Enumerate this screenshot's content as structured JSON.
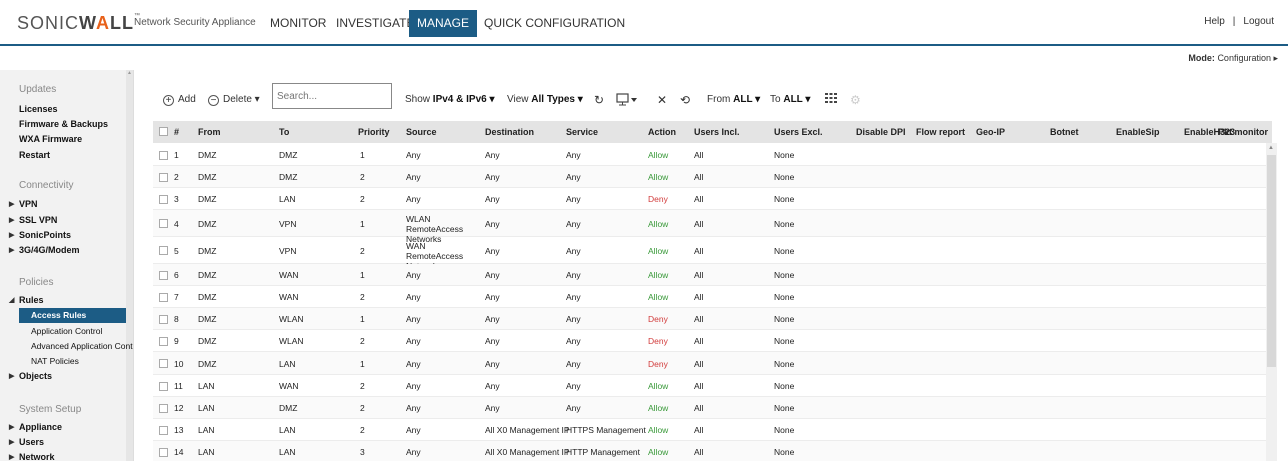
{
  "header": {
    "logo_pre": "SONIC",
    "logo_bold": "W",
    "logo_flame": "A",
    "logo_post": "LL",
    "logo_tm": "™",
    "appliance": "Network Security Appliance",
    "nav": [
      "MONITOR",
      "INVESTIGATE",
      "MANAGE",
      "QUICK CONFIGURATION"
    ],
    "active_nav": "MANAGE",
    "help": "Help",
    "sep": "|",
    "logout": "Logout",
    "mode_label": "Mode:",
    "mode_value": "Configuration ▸"
  },
  "sidebar": {
    "sections": [
      {
        "heading": "Updates",
        "items": [
          "Licenses",
          "Firmware & Backups",
          "WXA Firmware",
          "Restart"
        ]
      },
      {
        "heading": "Connectivity",
        "items": [
          "VPN",
          "SSL VPN",
          "SonicPoints",
          "3G/4G/Modem"
        ]
      },
      {
        "heading": "Policies",
        "items": [
          "Rules",
          "Access Rules",
          "Application Control",
          "Advanced Application Control",
          "NAT Policies",
          "Objects"
        ]
      },
      {
        "heading": "System Setup",
        "items": [
          "Appliance",
          "Users",
          "Network"
        ]
      }
    ],
    "active_item": "Access Rules"
  },
  "toolbar": {
    "add": "Add",
    "delete": "Delete ▾",
    "search_placeholder": "Search...",
    "show_label": "Show",
    "show_value": "IPv4 & IPv6 ▾",
    "view_label": "View",
    "view_value": "All Types ▾",
    "from_label": "From",
    "from_value": "ALL ▾",
    "to_label": "To",
    "to_value": "ALL ▾"
  },
  "table": {
    "columns": [
      "#",
      "From",
      "To",
      "Priority",
      "Source",
      "Destination",
      "Service",
      "Action",
      "Users Incl.",
      "Users Excl.",
      "Disable DPI",
      "Flow report",
      "Geo-IP",
      "Botnet",
      "EnableSip",
      "EnableH323",
      "Pkt monitor"
    ],
    "rows": [
      {
        "n": "1",
        "from": "DMZ",
        "to": "DMZ",
        "priority": "1",
        "source": "Any",
        "destination": "Any",
        "service": "Any",
        "action": "Allow",
        "incl": "All",
        "excl": "None"
      },
      {
        "n": "2",
        "from": "DMZ",
        "to": "DMZ",
        "priority": "2",
        "source": "Any",
        "destination": "Any",
        "service": "Any",
        "action": "Allow",
        "incl": "All",
        "excl": "None"
      },
      {
        "n": "3",
        "from": "DMZ",
        "to": "LAN",
        "priority": "2",
        "source": "Any",
        "destination": "Any",
        "service": "Any",
        "action": "Deny",
        "incl": "All",
        "excl": "None"
      },
      {
        "n": "4",
        "from": "DMZ",
        "to": "VPN",
        "priority": "1",
        "source": "WLAN RemoteAccess Networks",
        "destination": "Any",
        "service": "Any",
        "action": "Allow",
        "incl": "All",
        "excl": "None"
      },
      {
        "n": "5",
        "from": "DMZ",
        "to": "VPN",
        "priority": "2",
        "source": "WAN RemoteAccess Networks",
        "destination": "Any",
        "service": "Any",
        "action": "Allow",
        "incl": "All",
        "excl": "None"
      },
      {
        "n": "6",
        "from": "DMZ",
        "to": "WAN",
        "priority": "1",
        "source": "Any",
        "destination": "Any",
        "service": "Any",
        "action": "Allow",
        "incl": "All",
        "excl": "None"
      },
      {
        "n": "7",
        "from": "DMZ",
        "to": "WAN",
        "priority": "2",
        "source": "Any",
        "destination": "Any",
        "service": "Any",
        "action": "Allow",
        "incl": "All",
        "excl": "None"
      },
      {
        "n": "8",
        "from": "DMZ",
        "to": "WLAN",
        "priority": "1",
        "source": "Any",
        "destination": "Any",
        "service": "Any",
        "action": "Deny",
        "incl": "All",
        "excl": "None"
      },
      {
        "n": "9",
        "from": "DMZ",
        "to": "WLAN",
        "priority": "2",
        "source": "Any",
        "destination": "Any",
        "service": "Any",
        "action": "Deny",
        "incl": "All",
        "excl": "None"
      },
      {
        "n": "10",
        "from": "DMZ",
        "to": "LAN",
        "priority": "1",
        "source": "Any",
        "destination": "Any",
        "service": "Any",
        "action": "Deny",
        "incl": "All",
        "excl": "None"
      },
      {
        "n": "11",
        "from": "LAN",
        "to": "WAN",
        "priority": "2",
        "source": "Any",
        "destination": "Any",
        "service": "Any",
        "action": "Allow",
        "incl": "All",
        "excl": "None"
      },
      {
        "n": "12",
        "from": "LAN",
        "to": "DMZ",
        "priority": "2",
        "source": "Any",
        "destination": "Any",
        "service": "Any",
        "action": "Allow",
        "incl": "All",
        "excl": "None"
      },
      {
        "n": "13",
        "from": "LAN",
        "to": "LAN",
        "priority": "2",
        "source": "Any",
        "destination": "All X0 Management IP",
        "service": "HTTPS Management",
        "action": "Allow",
        "incl": "All",
        "excl": "None"
      },
      {
        "n": "14",
        "from": "LAN",
        "to": "LAN",
        "priority": "3",
        "source": "Any",
        "destination": "All X0 Management IP",
        "service": "HTTP Management",
        "action": "Allow",
        "incl": "All",
        "excl": "None"
      }
    ]
  },
  "colors": {
    "brand": "#1c5c85",
    "allow": "#3a9a3a",
    "deny": "#d23c3c",
    "flame": "#e8611a"
  }
}
